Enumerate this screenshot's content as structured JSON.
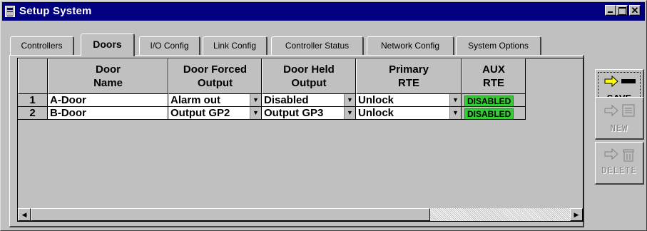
{
  "window": {
    "title": "Setup System",
    "controls": [
      "minimize",
      "maximize",
      "close"
    ],
    "close_glyph": "✕"
  },
  "tabs": [
    {
      "label": "Controllers",
      "active": false
    },
    {
      "label": "Doors",
      "active": true
    },
    {
      "label": "I/O Config",
      "active": false
    },
    {
      "label": "Link Config",
      "active": false
    },
    {
      "label": "Controller Status",
      "active": false
    },
    {
      "label": "Network Config",
      "active": false
    },
    {
      "label": "System Options",
      "active": false
    }
  ],
  "grid": {
    "columns": [
      {
        "line1": "Door",
        "line2": "Name"
      },
      {
        "line1": "Door Forced",
        "line2": "Output"
      },
      {
        "line1": "Door Held",
        "line2": "Output"
      },
      {
        "line1": "Primary",
        "line2": "RTE"
      },
      {
        "line1": "AUX",
        "line2": "RTE"
      }
    ],
    "rows": [
      {
        "num": "1",
        "door_name": "A-Door",
        "forced_output": "Alarm out",
        "held_output": "Disabled",
        "primary_rte": "Unlock",
        "aux_rte": "DISABLED"
      },
      {
        "num": "2",
        "door_name": "B-Door",
        "forced_output": "Output GP2",
        "held_output": "Output GP3",
        "primary_rte": "Unlock",
        "aux_rte": "DISABLED"
      }
    ],
    "dropdown_glyph": "▼",
    "badge_color": "#33cc33"
  },
  "scrollbar": {
    "left_glyph": "◀",
    "right_glyph": "▶"
  },
  "side_buttons": {
    "save": {
      "label": "SAVE",
      "enabled": true,
      "icon": "arrow-to-slot-icon"
    },
    "new": {
      "label": "NEW",
      "enabled": false,
      "icon": "arrow-to-list-icon"
    },
    "delete": {
      "label": "DELETE",
      "enabled": false,
      "icon": "arrow-to-trash-icon"
    }
  },
  "colors": {
    "title_bar": "#000080",
    "face": "#c0c0c0",
    "save_arrow": "#ffff00"
  }
}
